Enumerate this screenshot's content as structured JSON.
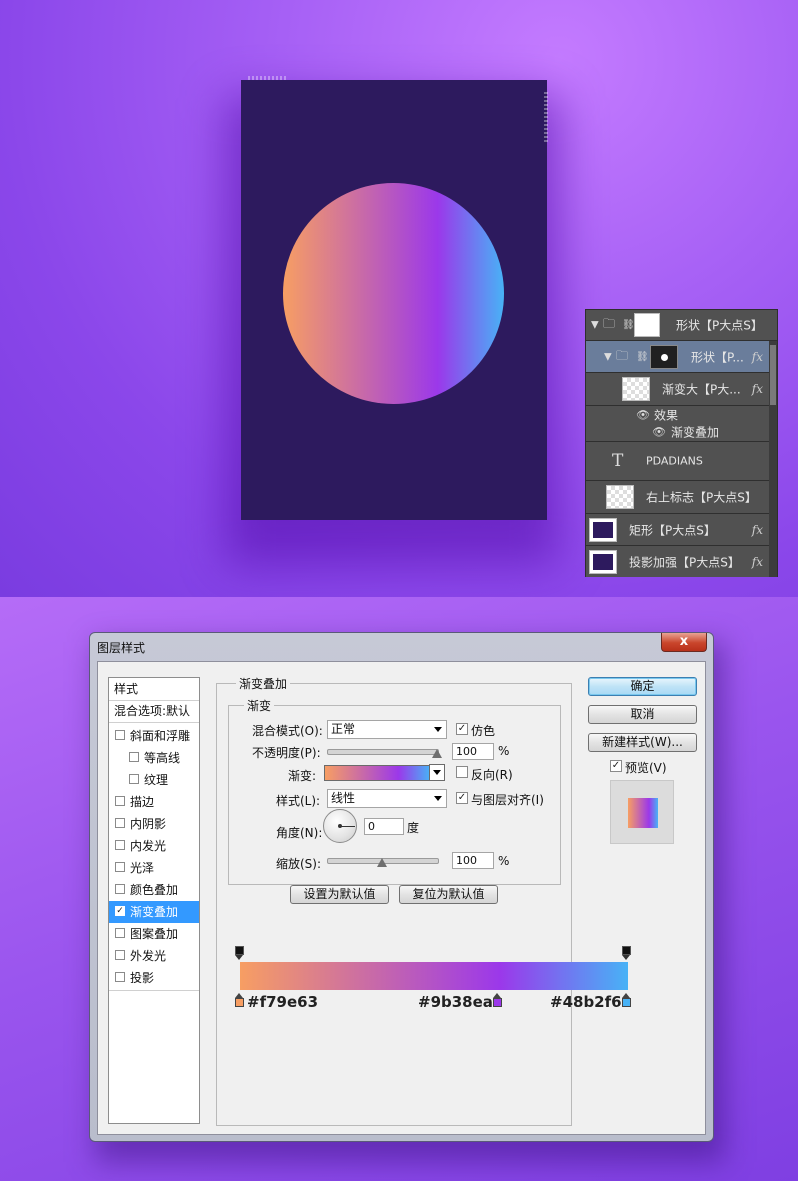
{
  "colors": {
    "poster_bg": "#2d1a5e",
    "gradient_start": "#f79e63",
    "gradient_mid": "#9b38ea",
    "gradient_end": "#48b2f6",
    "selection_blue": "#3399ff"
  },
  "layers_panel": {
    "rows": [
      {
        "name": "形状【P大点S】",
        "fx": "",
        "icons": [
          "expand-arrow-icon",
          "folder-icon",
          "link-icon"
        ]
      },
      {
        "name": "形状【P...",
        "fx": "fx",
        "icons": [
          "expand-arrow-icon",
          "folder-icon",
          "link-icon"
        ]
      },
      {
        "name": "渐变大【P大...",
        "fx": "fx"
      },
      {
        "name": "效果",
        "fx": "",
        "icons": [
          "eye-icon"
        ]
      },
      {
        "name": "渐变叠加",
        "fx": "",
        "icons": [
          "eye-icon"
        ]
      },
      {
        "name": "PDADIANS",
        "fx": "",
        "type_glyph": "T"
      },
      {
        "name": "右上标志【P大点S】",
        "fx": ""
      },
      {
        "name": "矩形【P大点S】",
        "fx": "fx"
      },
      {
        "name": "投影加强【P大点S】",
        "fx": "fx"
      }
    ]
  },
  "dialog": {
    "title": "图层样式",
    "close_glyph": "x",
    "styles_list": {
      "header": "样式",
      "blend_default": "混合选项:默认",
      "items": [
        {
          "label": "斜面和浮雕",
          "checked": false
        },
        {
          "label": "等高线",
          "checked": false
        },
        {
          "label": "纹理",
          "checked": false
        },
        {
          "label": "描边",
          "checked": false
        },
        {
          "label": "内阴影",
          "checked": false
        },
        {
          "label": "内发光",
          "checked": false
        },
        {
          "label": "光泽",
          "checked": false
        },
        {
          "label": "颜色叠加",
          "checked": false
        },
        {
          "label": "渐变叠加",
          "checked": true
        },
        {
          "label": "图案叠加",
          "checked": false
        },
        {
          "label": "外发光",
          "checked": false
        },
        {
          "label": "投影",
          "checked": false
        }
      ],
      "check_mark": "✓"
    },
    "section": {
      "title": "渐变叠加",
      "subgroup": "渐变",
      "blend_mode_label": "混合模式(O):",
      "blend_mode_value": "正常",
      "dither_label": "仿色",
      "opacity_label": "不透明度(P):",
      "opacity_value": "100",
      "opacity_unit": "%",
      "opacity_level": 1.0,
      "gradient_label": "渐变:",
      "reverse_label": "反向(R)",
      "style_label": "样式(L):",
      "style_value": "线性",
      "align_label": "与图层对齐(I)",
      "angle_label": "角度(N):",
      "angle_value": "0",
      "angle_unit": "度",
      "scale_label": "缩放(S):",
      "scale_value": "100",
      "scale_unit": "%",
      "scale_level": 0.5,
      "set_default": "设置为默认值",
      "reset_default": "复位为默认值"
    },
    "buttons": {
      "ok": "确定",
      "cancel": "取消",
      "new_style": "新建样式(W)...",
      "preview": "预览(V)"
    }
  },
  "gradient_editor": {
    "stops": [
      {
        "hex": "#f79e63"
      },
      {
        "hex": "#9b38ea"
      },
      {
        "hex": "#48b2f6"
      }
    ]
  }
}
